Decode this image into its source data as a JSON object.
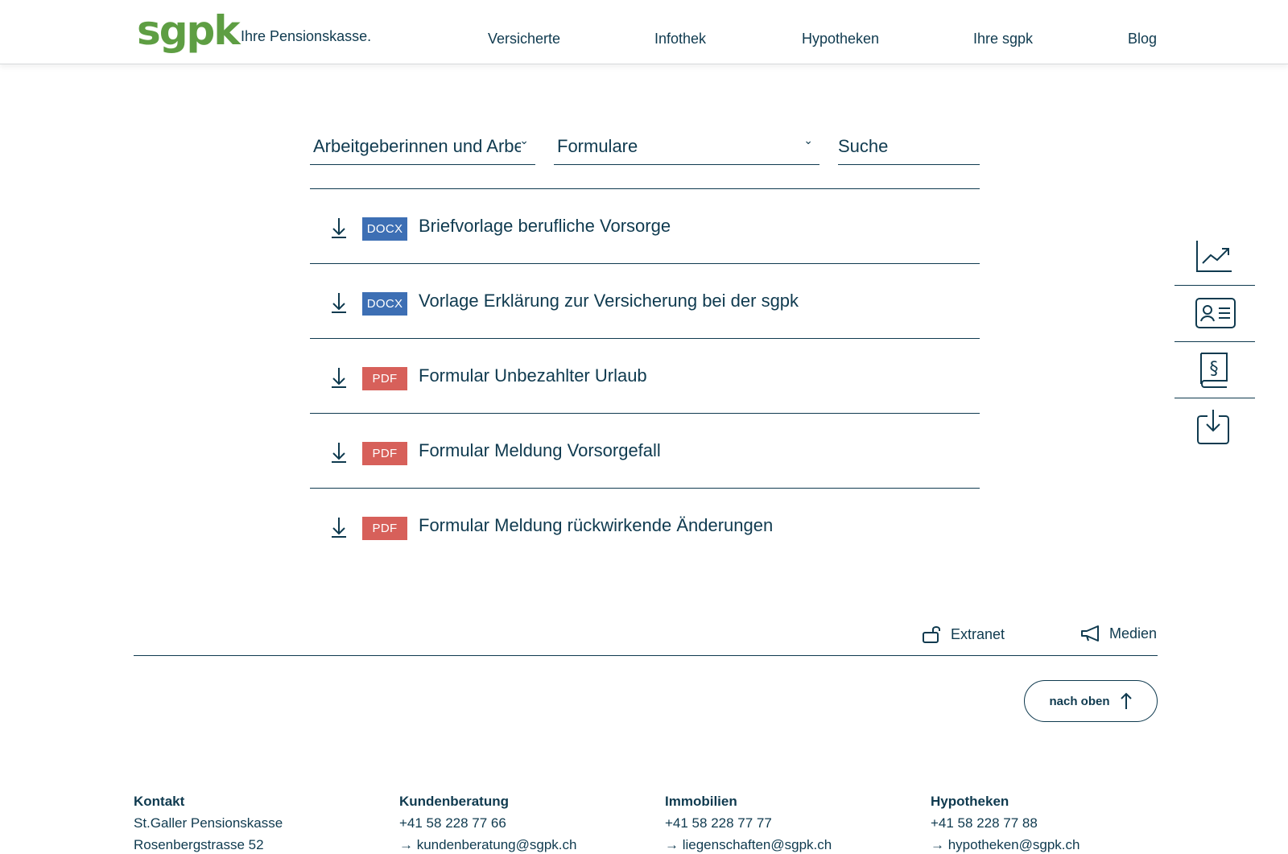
{
  "brand": {
    "logo": "sgpk",
    "tagline": "Ihre Pensionskasse."
  },
  "nav": [
    "Versicherte",
    "Infothek",
    "Hypotheken",
    "Ihre sgpk",
    "Blog"
  ],
  "filters": {
    "audience": "Arbeitgeberinnen und Arbeitgeber",
    "category": "Formulare",
    "search_placeholder": "Suche"
  },
  "documents": [
    {
      "type": "DOCX",
      "title": "Briefvorlage berufliche Vorsorge"
    },
    {
      "type": "DOCX",
      "title": "Vorlage Erklärung zur Versicherung bei der sgpk"
    },
    {
      "type": "PDF",
      "title": "Formular Unbezahlter Urlaub"
    },
    {
      "type": "PDF",
      "title": "Formular Meldung Vorsorgefall"
    },
    {
      "type": "PDF",
      "title": "Formular Meldung rückwirkende Änderungen"
    }
  ],
  "side_icons": [
    "chart-line-icon",
    "contact-card-icon",
    "law-book-icon",
    "download-tray-icon"
  ],
  "utility": {
    "extranet": "Extranet",
    "medien": "Medien"
  },
  "back_to_top": "nach oben",
  "footer": [
    {
      "heading": "Kontakt",
      "lines": [
        "St.Galler Pensionskasse",
        "Rosenbergstrasse 52"
      ]
    },
    {
      "heading": "Kundenberatung",
      "lines": [
        "+41 58 228 77 66",
        "→ kundenberatung@sgpk.ch"
      ]
    },
    {
      "heading": "Immobilien",
      "lines": [
        "+41 58 228 77 77",
        "→ liegenschaften@sgpk.ch"
      ]
    },
    {
      "heading": "Hypotheken",
      "lines": [
        "+41 58 228 77 88",
        "→ hypotheken@sgpk.ch"
      ]
    }
  ],
  "colors": {
    "brand_green": "#5e9e43",
    "text_navy": "#0f3a4f",
    "docx_blue": "#3d6fb4",
    "pdf_red": "#d7605a"
  }
}
